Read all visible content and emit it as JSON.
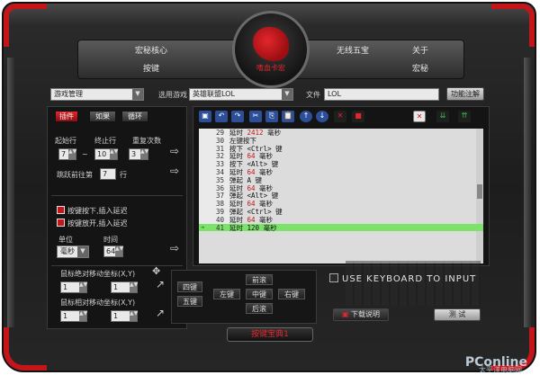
{
  "top_nav": {
    "macro_core": "宏秘核心",
    "keys": "按键",
    "wireless_treasure": "无线五宝",
    "about": "关于",
    "macro": "宏秘",
    "logo_text": "嗜血卡宏"
  },
  "toolbar": {
    "game_manager": "游戏管理",
    "select_game_label": "选用游戏",
    "select_game_value": "英雄联盟LOL",
    "file_label": "文件",
    "file_value": "LOL",
    "functional_annotation": "功能注解"
  },
  "left_panel": {
    "tabs": [
      "插件",
      "如果",
      "循环"
    ],
    "start_line_label": "起始行",
    "end_line_label": "终止行",
    "repeat_label": "重复次数",
    "start_line_value": "7",
    "end_line_value": "10",
    "repeat_value": "3",
    "jump_label": "跳跃前往第",
    "jump_value": "7",
    "jump_suffix": "行",
    "insert_delay_press": "按键按下,插入延迟",
    "insert_delay_release": "按键放开,插入延迟",
    "unit_label": "单位",
    "time_label": "时间",
    "unit_value": "毫秒",
    "time_value": "64",
    "mouse_abs_label": "鼠标绝对移动坐标(X,Y)",
    "mouse_rel_label": "鼠标相对移动坐标(X,Y)",
    "abs_x": "1",
    "abs_y": "1",
    "rel_x": "1",
    "rel_y": "1"
  },
  "script_lines": [
    {
      "n": "29",
      "text": "延时 ",
      "value": "2412",
      "unit": " 毫秒"
    },
    {
      "n": "30",
      "text": "左键按下",
      "value": "",
      "unit": ""
    },
    {
      "n": "31",
      "text": "按下 <Ctrl> 键",
      "value": "",
      "unit": ""
    },
    {
      "n": "32",
      "text": "延时 ",
      "value": "64",
      "unit": " 毫秒"
    },
    {
      "n": "33",
      "text": "按下 <Alt> 键",
      "value": "",
      "unit": ""
    },
    {
      "n": "34",
      "text": "延时 ",
      "value": "64",
      "unit": " 毫秒"
    },
    {
      "n": "35",
      "text": "弹起 A 键",
      "value": "",
      "unit": ""
    },
    {
      "n": "36",
      "text": "延时 ",
      "value": "64",
      "unit": " 毫秒"
    },
    {
      "n": "37",
      "text": "弹起 <Alt> 键",
      "value": "",
      "unit": ""
    },
    {
      "n": "38",
      "text": "延时 ",
      "value": "64",
      "unit": " 毫秒"
    },
    {
      "n": "39",
      "text": "弹起 <Ctrl> 键",
      "value": "",
      "unit": ""
    },
    {
      "n": "40",
      "text": "延时 ",
      "value": "64",
      "unit": " 毫秒"
    },
    {
      "n": "41",
      "text": "延时 120 毫秒",
      "value": "",
      "unit": "",
      "selected": true
    }
  ],
  "mouse_keys": {
    "fourth_key": "四键",
    "fifth_key": "五键",
    "forward": "前滚",
    "left": "左键",
    "middle": "中键",
    "right": "右键",
    "back": "后滚"
  },
  "right_panel": {
    "use_keyboard": "USE KEYBOARD TO INPUT",
    "download_help": "下载说明",
    "test": "测 试"
  },
  "bottom_title": "按键宝典1",
  "watermark": {
    "brand": "PConline",
    "sub": "太平洋电脑网"
  },
  "colors": {
    "accent_red": "#c2161b",
    "selected_line": "#7be26a",
    "frame_dark": "#1d1d1d"
  }
}
